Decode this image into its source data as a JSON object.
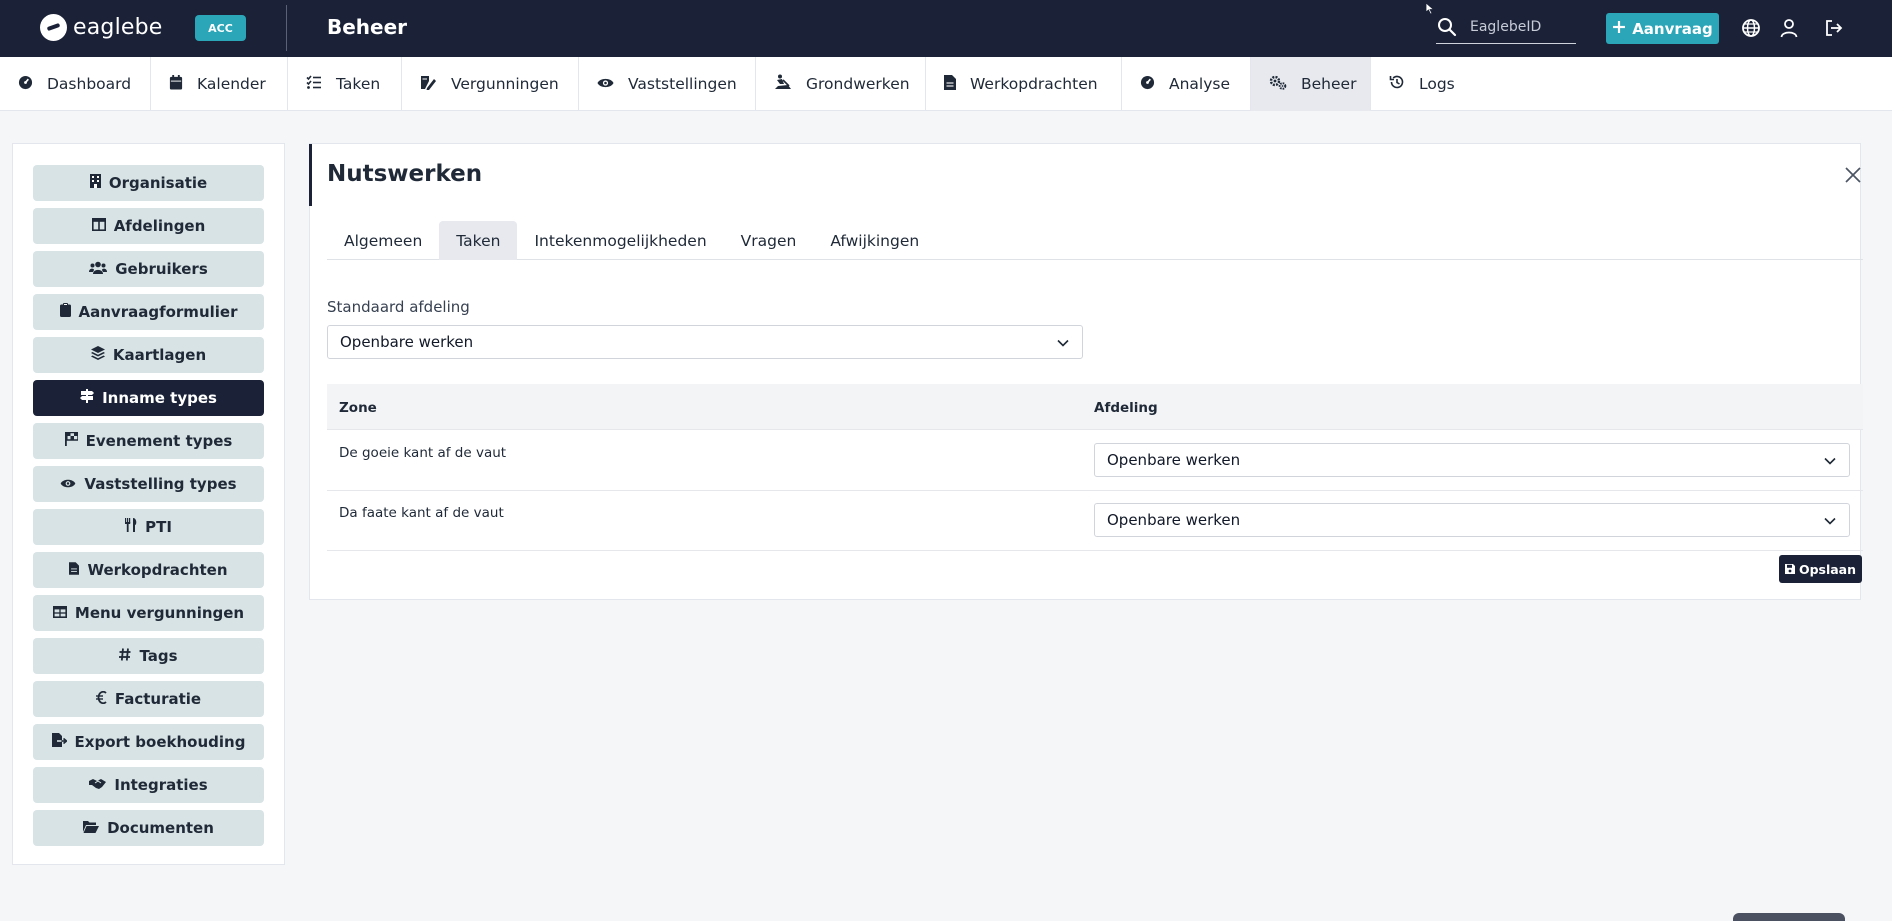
{
  "topbar": {
    "brand": "eaglebe",
    "env_badge": "ACC",
    "title": "Beheer",
    "search_placeholder": "EaglebeID",
    "new_request_label": "Aanvraag",
    "icons": [
      "search-icon",
      "globe-icon",
      "user-icon",
      "logout-icon"
    ]
  },
  "nav": {
    "items": [
      {
        "label": "Dashboard",
        "icon": "dashboard-icon"
      },
      {
        "label": "Kalender",
        "icon": "calendar-icon"
      },
      {
        "label": "Taken",
        "icon": "tasks-icon"
      },
      {
        "label": "Vergunningen",
        "icon": "permit-icon"
      },
      {
        "label": "Vaststellingen",
        "icon": "eye-icon"
      },
      {
        "label": "Grondwerken",
        "icon": "digging-icon"
      },
      {
        "label": "Werkopdrachten",
        "icon": "document-icon"
      },
      {
        "label": "Analyse",
        "icon": "gauge-icon"
      },
      {
        "label": "Beheer",
        "icon": "cogs-icon",
        "active": true
      },
      {
        "label": "Logs",
        "icon": "history-icon"
      }
    ]
  },
  "sidebar": {
    "items": [
      {
        "label": "Organisatie",
        "icon": "building-icon"
      },
      {
        "label": "Afdelingen",
        "icon": "columns-icon"
      },
      {
        "label": "Gebruikers",
        "icon": "users-icon"
      },
      {
        "label": "Aanvraagformulier",
        "icon": "clipboard-icon"
      },
      {
        "label": "Kaartlagen",
        "icon": "layers-icon"
      },
      {
        "label": "Inname types",
        "icon": "signs-icon",
        "active": true
      },
      {
        "label": "Evenement types",
        "icon": "flag-icon"
      },
      {
        "label": "Vaststelling types",
        "icon": "eye-icon"
      },
      {
        "label": "PTI",
        "icon": "utensils-icon"
      },
      {
        "label": "Werkopdrachten",
        "icon": "document-icon"
      },
      {
        "label": "Menu vergunningen",
        "icon": "table-icon"
      },
      {
        "label": "Tags",
        "icon": "hashtag-icon"
      },
      {
        "label": "Facturatie",
        "icon": "euro-icon"
      },
      {
        "label": "Export boekhouding",
        "icon": "file-export-icon"
      },
      {
        "label": "Integraties",
        "icon": "handshake-icon"
      },
      {
        "label": "Documenten",
        "icon": "folder-open-icon"
      }
    ]
  },
  "panel": {
    "title": "Nutswerken",
    "tabs": [
      {
        "label": "Algemeen"
      },
      {
        "label": "Taken",
        "active": true
      },
      {
        "label": "Intekenmogelijkheden"
      },
      {
        "label": "Vragen"
      },
      {
        "label": "Afwijkingen"
      }
    ],
    "default_department_label": "Standaard afdeling",
    "default_department_value": "Openbare werken",
    "table": {
      "headers": [
        "Zone",
        "Afdeling"
      ],
      "rows": [
        {
          "zone": "De goeie kant af de vaut",
          "afdeling": "Openbare werken"
        },
        {
          "zone": "Da faate kant af de vaut",
          "afdeling": "Openbare werken"
        }
      ]
    },
    "save_label": "Opslaan"
  },
  "colors": {
    "navy": "#1b2238",
    "teal": "#2aa6b8",
    "sidebar_button": "#d8e3e5",
    "active_tab": "#e7e9ee"
  }
}
